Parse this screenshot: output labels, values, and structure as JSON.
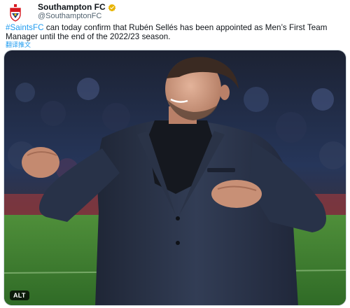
{
  "account": {
    "display_name": "Southampton FC",
    "handle": "@SouthamptonFC",
    "avatar_icon": "southampton-crest-icon",
    "verified_icon": "verified-gold-badge-icon"
  },
  "tweet": {
    "hashtag": "#SaintsFC",
    "text": " can today confirm that Rubén Sellés has been appointed as Men’s First Team Manager until the end of the 2022/23 season.",
    "translate_label": "翻译推文"
  },
  "media": {
    "alt_badge": "ALT"
  },
  "colors": {
    "link": "#1d9bf0",
    "verified": "#e8b400",
    "crest_red": "#d71920"
  }
}
